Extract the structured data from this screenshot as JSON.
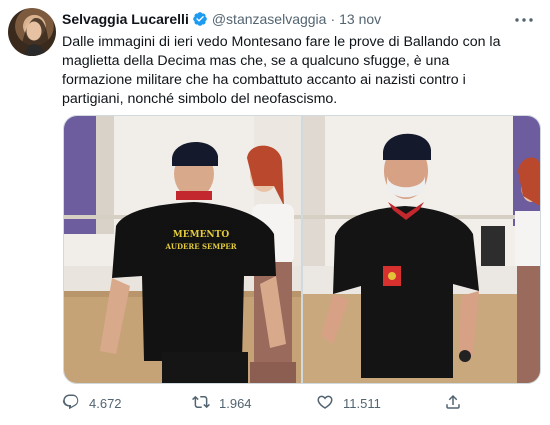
{
  "tweet": {
    "display_name": "Selvaggia Lucarelli",
    "handle": "@stanzaselvaggia",
    "separator": "·",
    "date": "13 nov",
    "text": "Dalle immagini di ieri vedo Montesano fare le prove di Ballando con la maglietta della Decima mas che, se a qualcuno sfugge, è una formazione militare che ha combattuto accanto ai nazisti contro i partigiani, nonché simbolo del neofascismo.",
    "shirt_text_line1": "MEMENTO",
    "shirt_text_line2": "AUDERE SEMPER"
  },
  "actions": {
    "reply_count": "4.672",
    "retweet_count": "1.964",
    "like_count": "11.511"
  },
  "icons": {
    "verified": "verified-badge-icon",
    "more": "more-horizontal-icon",
    "reply": "reply-icon",
    "retweet": "retweet-icon",
    "like": "heart-icon",
    "share": "share-icon"
  },
  "colors": {
    "verified_blue": "#1d9bf0",
    "secondary_text": "#536471",
    "primary_text": "#0f1419"
  }
}
